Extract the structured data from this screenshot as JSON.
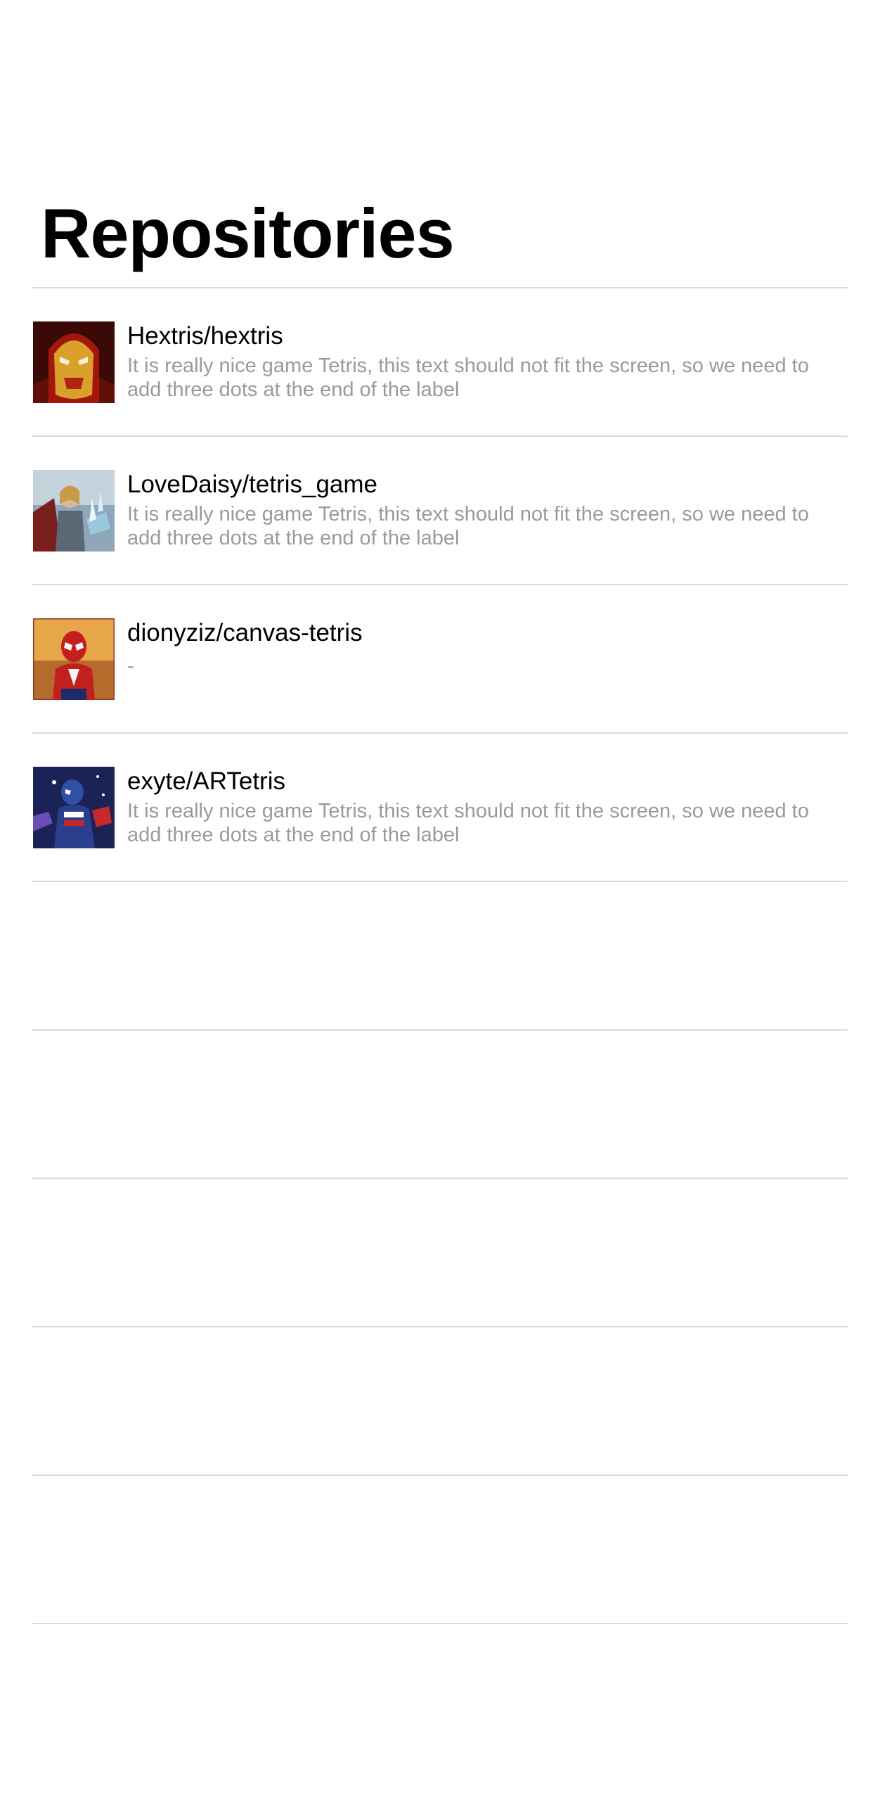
{
  "header": {
    "title": "Repositories"
  },
  "repositories": [
    {
      "name": "Hextris/hextris",
      "description": "It is really nice game Tetris, this text should not fit the screen, so we need to add three dots at the end of the label",
      "avatar_icon": "iron-man-avatar"
    },
    {
      "name": "LoveDaisy/tetris_game",
      "description": "It is really nice game Tetris, this text should not fit the screen, so we need to add three dots at the end of the label",
      "avatar_icon": "thor-avatar"
    },
    {
      "name": "dionyziz/canvas-tetris",
      "description": "-",
      "avatar_icon": "spider-man-avatar"
    },
    {
      "name": "exyte/ARTetris",
      "description": "It is really nice game Tetris, this text should not fit the screen, so we need to add three dots at the end of the label",
      "avatar_icon": "captain-america-avatar"
    }
  ],
  "colors": {
    "title": "#000000",
    "name": "#000000",
    "description": "#9a9a9a",
    "separator": "#dadada",
    "background": "#ffffff"
  }
}
